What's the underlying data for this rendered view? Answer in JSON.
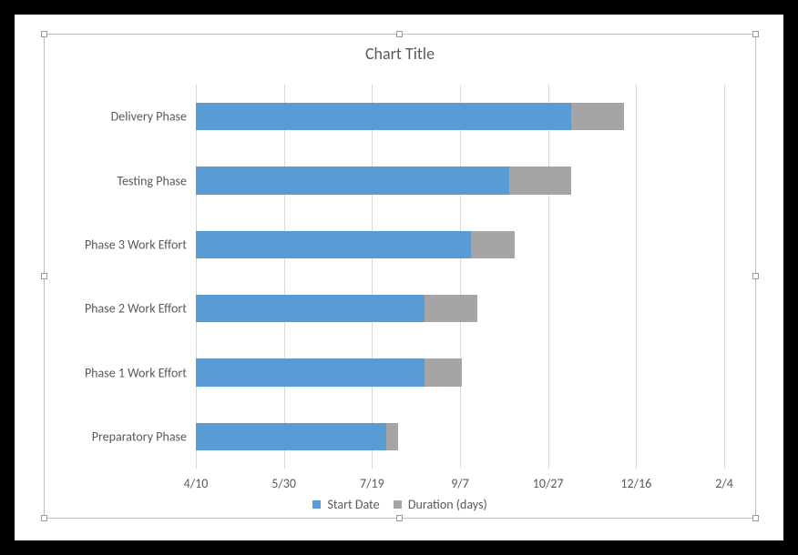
{
  "chart_data": {
    "type": "bar",
    "orientation": "horizontal",
    "stacked": true,
    "title": "Chart Title",
    "x_axis": {
      "type": "date",
      "min": "4/10",
      "max": "2/4",
      "ticks": [
        "4/10",
        "5/30",
        "7/19",
        "9/7",
        "10/27",
        "12/16",
        "2/4"
      ],
      "tick_serial": [
        42104,
        42154,
        42204,
        42254,
        42304,
        42354,
        42404
      ]
    },
    "categories": [
      "Preparatory Phase",
      "Phase 1 Work Effort",
      "Phase 2 Work Effort",
      "Phase 3 Work Effort",
      "Testing Phase",
      "Delivery Phase"
    ],
    "series": [
      {
        "name": "Start Date",
        "color": "#5b9bd5",
        "values": [
          42212,
          42234,
          42234,
          42260,
          42282,
          42317
        ]
      },
      {
        "name": "Duration (days)",
        "color": "#a5a5a5",
        "values": [
          7,
          21,
          30,
          25,
          35,
          30
        ]
      }
    ]
  }
}
